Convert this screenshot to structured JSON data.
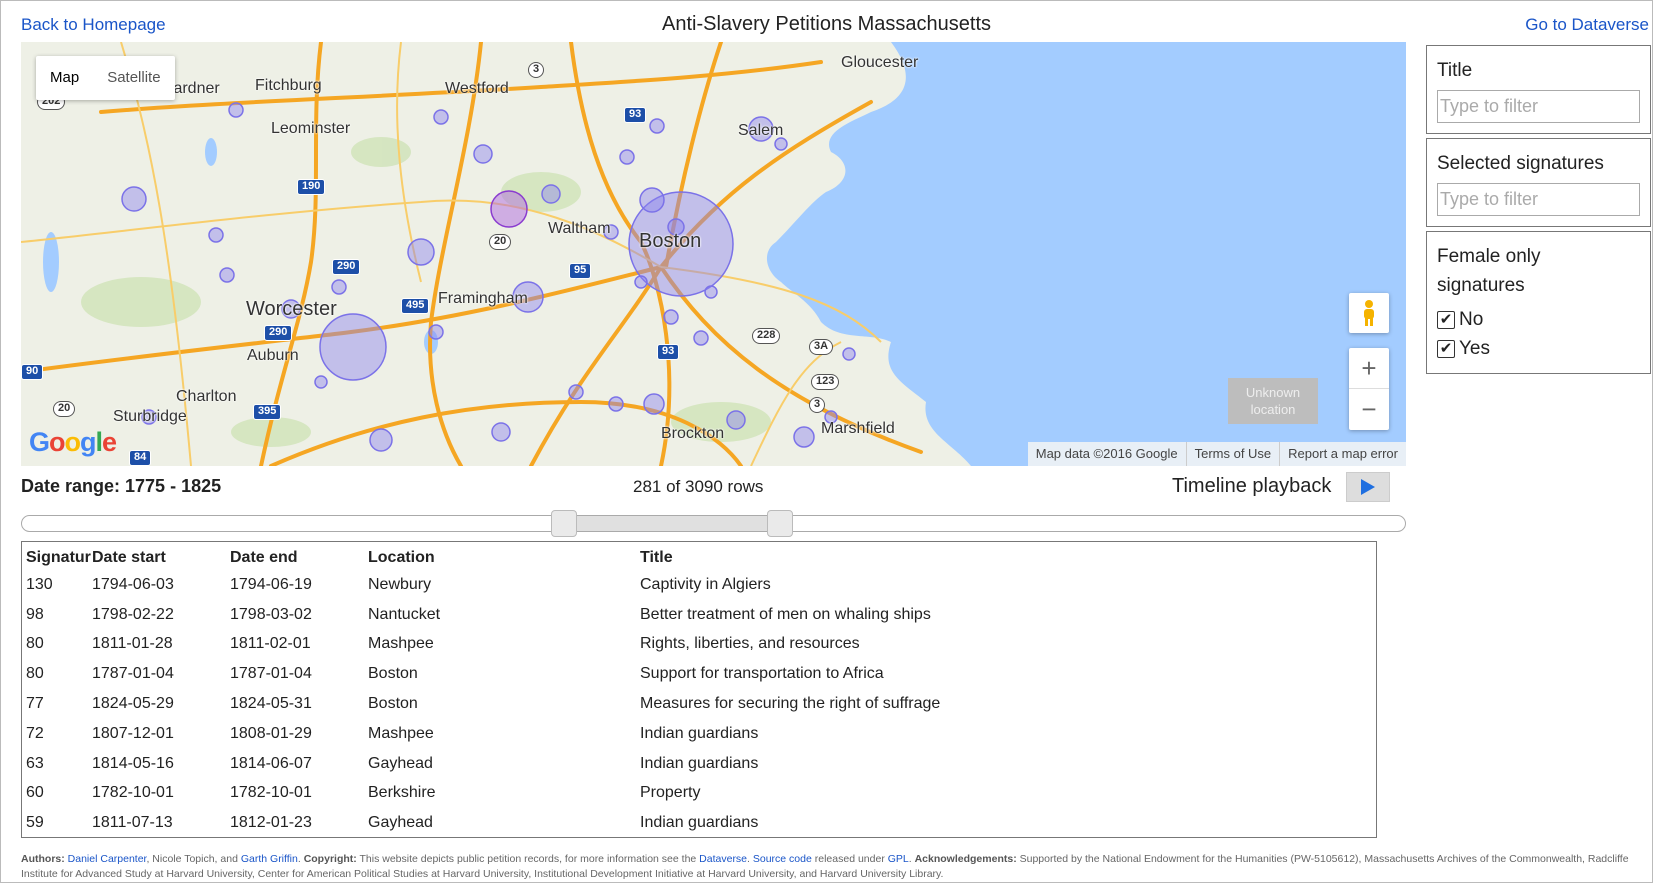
{
  "header": {
    "back_link": "Back to Homepage",
    "title": "Anti-Slavery Petitions Massachusetts",
    "dataverse_link": "Go to Dataverse"
  },
  "map": {
    "type_map": "Map",
    "type_satellite": "Satellite",
    "unknown_location": "Unknown location",
    "zoom_in": "+",
    "zoom_out": "−",
    "attribution": "Map data ©2016 Google",
    "terms": "Terms of Use",
    "report": "Report a map error",
    "logo": "Google",
    "cities": {
      "gardner": "Gardner",
      "fitchburg": "Fitchburg",
      "westford": "Westford",
      "gloucester": "Gloucester",
      "leominster": "Leominster",
      "salem": "Salem",
      "waltham": "Waltham",
      "boston": "Boston",
      "framingham": "Framingham",
      "worcester": "Worcester",
      "auburn": "Auburn",
      "charlton": "Charlton",
      "sturbridge": "Sturbridge",
      "brockton": "Brockton",
      "marshfield": "Marshfield"
    },
    "shields": {
      "r202": "202",
      "r3": "3",
      "r93a": "93",
      "r190": "190",
      "r20a": "20",
      "r290a": "290",
      "r95": "95",
      "r495": "495",
      "r290b": "290",
      "r228": "228",
      "r3a": "3A",
      "r93b": "93",
      "r123": "123",
      "r3b": "3",
      "r395": "395",
      "r20b": "20",
      "r84": "84",
      "r90": "90"
    },
    "colors": {
      "water": "#a3ccff",
      "land": "#eef0e6",
      "highway": "#f5a623",
      "marker": "#8c83f0"
    }
  },
  "filters": {
    "title_label": "Title",
    "title_placeholder": "Type to filter",
    "signatures_label": "Selected signatures",
    "signatures_placeholder": "Type to filter",
    "female_label": "Female only signatures",
    "no_label": "No",
    "yes_label": "Yes"
  },
  "timeline": {
    "date_range": "Date range: 1775 - 1825",
    "row_count": "281 of 3090 rows",
    "playback_label": "Timeline playback",
    "range_start": 1775,
    "range_end": 1825
  },
  "table": {
    "headers": [
      "Signatur",
      "Date start",
      "Date end",
      "Location",
      "Title"
    ],
    "rows": [
      [
        "130",
        "1794-06-03",
        "1794-06-19",
        "Newbury",
        "Captivity in Algiers"
      ],
      [
        "98",
        "1798-02-22",
        "1798-03-02",
        "Nantucket",
        "Better treatment of men on whaling ships"
      ],
      [
        "80",
        "1811-01-28",
        "1811-02-01",
        "Mashpee",
        "Rights, liberties, and resources"
      ],
      [
        "80",
        "1787-01-04",
        "1787-01-04",
        "Boston",
        "Support for transportation to Africa"
      ],
      [
        "77",
        "1824-05-29",
        "1824-05-31",
        "Boston",
        "Measures for securing the right of suffrage"
      ],
      [
        "72",
        "1807-12-01",
        "1808-01-29",
        "Mashpee",
        "Indian guardians"
      ],
      [
        "63",
        "1814-05-16",
        "1814-06-07",
        "Gayhead",
        "Indian guardians"
      ],
      [
        "60",
        "1782-10-01",
        "1782-10-01",
        "Berkshire",
        "Property"
      ],
      [
        "59",
        "1811-07-13",
        "1812-01-23",
        "Gayhead",
        "Indian guardians"
      ]
    ]
  },
  "footer": {
    "authors_label": "Authors:",
    "author1": "Daniel Carpenter",
    "authors_mid": ", Nicole Topich, and ",
    "author2": "Garth Griffin",
    "copyright_label": "Copyright:",
    "copyright_text": "This website depicts public petition records, for more information see the ",
    "dataverse": "Dataverse",
    "source_code": "Source code",
    "released_text": " released under ",
    "gpl": "GPL",
    "ack_label": "Acknowledgements:",
    "ack_text": "Supported by the National Endowment for the Humanities (PW-5105612), Massachusetts Archives of the Commonwealth, Radcliffe Institute for Advanced Study at Harvard University, Center for American Political Studies at Harvard University, Institutional Development Initiative at Harvard University, and Harvard University Library."
  }
}
